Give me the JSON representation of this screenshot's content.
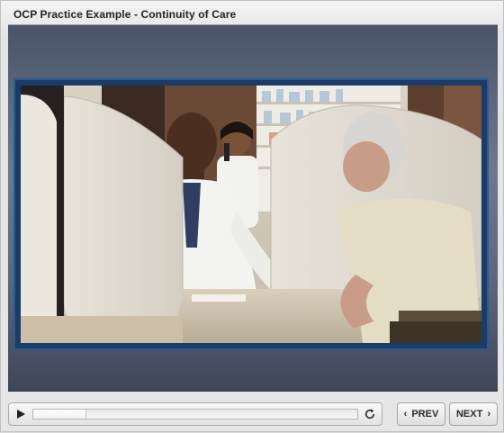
{
  "window": {
    "title": "OCP Practice Example - Continuity of Care"
  },
  "video": {
    "scene": "pharmacy-counter"
  },
  "player": {
    "progress": 0.16,
    "play_icon": "play-icon",
    "replay_icon": "replay-icon"
  },
  "nav": {
    "prev_label": "PREV",
    "next_label": "NEXT",
    "prev_icon": "chevron-left-icon",
    "next_icon": "chevron-right-icon"
  }
}
